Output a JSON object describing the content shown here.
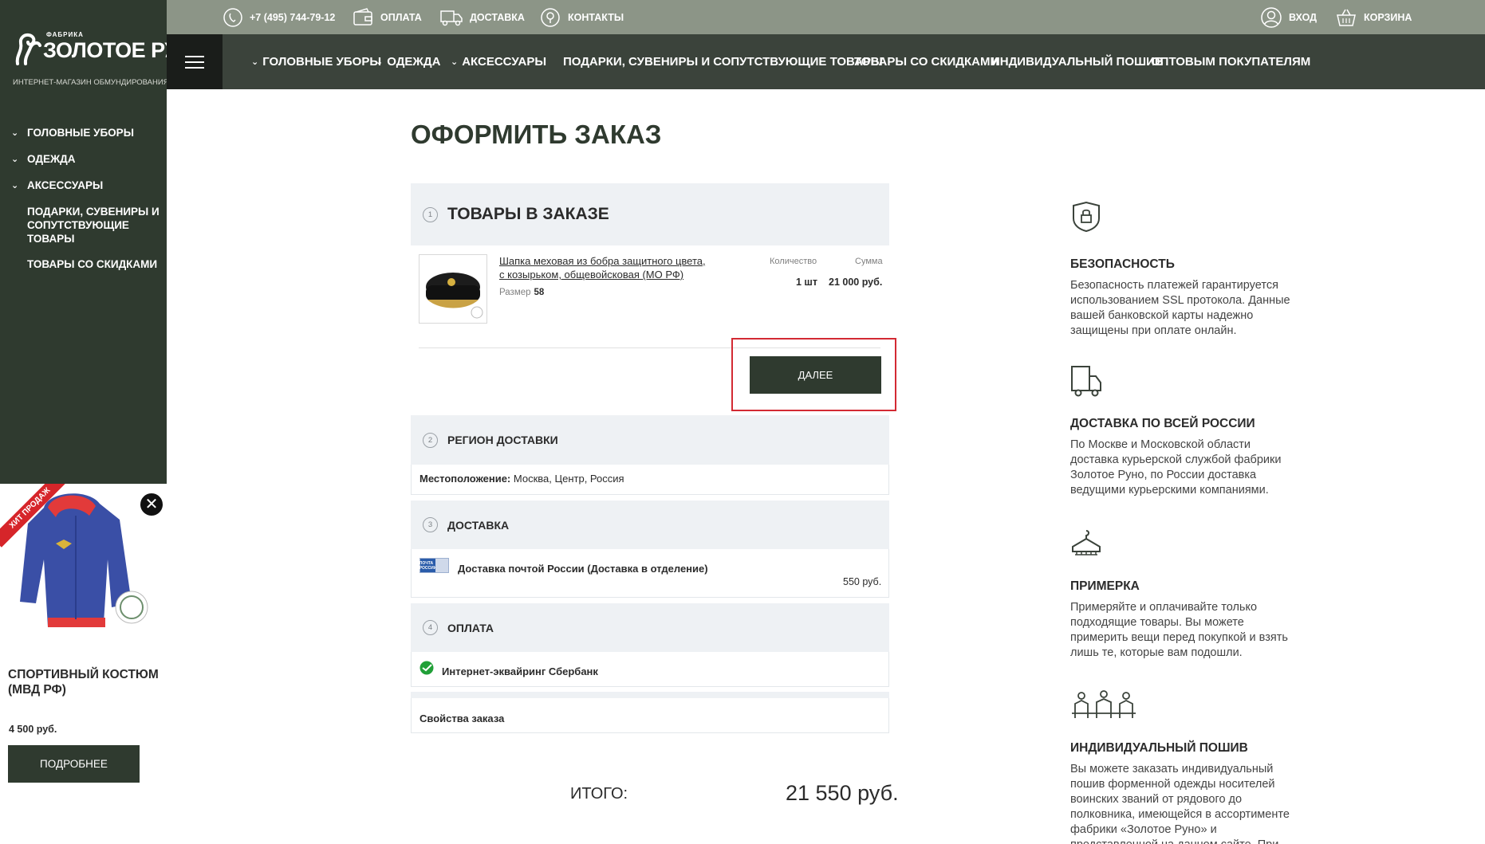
{
  "brand": {
    "small": "ФАБРИКА",
    "name": "ЗОЛОТОЕ РУНО",
    "tagline": "ИНТЕРНЕТ-МАГАЗИН ОБМУНДИРОВАНИЯ"
  },
  "topbar": {
    "phone": "+7 (495) 744-79-12",
    "payment": "ОПЛАТА",
    "delivery": "ДОСТАВКА",
    "contacts": "КОНТАКТЫ",
    "login": "ВХОД",
    "cart": "КОРЗИНА"
  },
  "main_nav": {
    "items": [
      {
        "label": "ГОЛОВНЫЕ УБОРЫ"
      },
      {
        "label": "ОДЕЖДА"
      },
      {
        "label": "АКСЕССУАРЫ"
      },
      {
        "label": "ПОДАРКИ, СУВЕНИРЫ И СОПУТСТВУЮЩИЕ ТОВАРЫ"
      },
      {
        "label": "ТОВАРЫ СО СКИДКАМИ"
      },
      {
        "label": "ИНДИВИДУАЛЬНЫЙ ПОШИВ"
      },
      {
        "label": "ОПТОВЫМ ПОКУПАТЕЛЯМ"
      }
    ]
  },
  "sidebar": {
    "items": [
      {
        "label": "ГОЛОВНЫЕ УБОРЫ"
      },
      {
        "label": "ОДЕЖДА"
      },
      {
        "label": "АКСЕССУАРЫ"
      },
      {
        "label": "ПОДАРКИ, СУВЕНИРЫ И СОПУТСТВУЮЩИЕ ТОВАРЫ"
      },
      {
        "label": "ТОВАРЫ СО СКИДКАМИ"
      }
    ]
  },
  "promo": {
    "ribbon": "ХИТ ПРОДАЖ",
    "title": "СПОРТИВНЫЙ КОСТЮМ (МВД РФ)",
    "price": "4 500 руб.",
    "button": "ПОДРОБНЕЕ"
  },
  "order": {
    "title": "ОФОРМИТЬ ЗАКАЗ",
    "section1": {
      "num": "1",
      "title": "ТОВАРЫ В ЗАКАЗЕ"
    },
    "product": {
      "name": "Шапка меховая из бобра защитного цвета, с козырьком, общевойсковая (МО РФ)",
      "size_label": "Размер",
      "size_value": "58",
      "qty_label": "Количество",
      "sum_label": "Сумма",
      "qty": "1 шт",
      "sum": "21 000 руб."
    },
    "next_button": "ДАЛЕЕ",
    "section2": {
      "num": "2",
      "title": "РЕГИОН ДОСТАВКИ",
      "location_label": "Местоположение:",
      "location_value": "Москва, Центр, Россия"
    },
    "section3": {
      "num": "3",
      "title": "ДОСТАВКА",
      "method": "Доставка почтой России (Доставка в отделение)",
      "price": "550 руб.",
      "logo_text": "ПОЧТА РОССИИ"
    },
    "section4": {
      "num": "4",
      "title": "ОПЛАТА",
      "method": "Интернет-эквайринг Сбербанк"
    },
    "properties": "Свойства заказа",
    "total_label": "ИТОГО:",
    "total_value": "21 550 руб."
  },
  "features": [
    {
      "icon": "shield-lock-icon",
      "title": "БЕЗОПАСНОСТЬ",
      "text": "Безопасность платежей гарантируется использованием SSL протокола. Данные вашей банковской карты надежно защищены при оплате онлайн."
    },
    {
      "icon": "truck-icon",
      "title": "ДОСТАВКА ПО ВСЕЙ РОССИИ",
      "text": "По Москве и Московской области доставка курьерской службой фабрики Золотое Руно, по России доставка ведущими курьерскими компаниями."
    },
    {
      "icon": "hanger-icon",
      "title": "ПРИМЕРКА",
      "text": "Примеряйте и оплачивайте только подходящие товары. Вы можете примерить вещи перед покупкой и взять лишь те, которые вам подошли."
    },
    {
      "icon": "tailoring-icon",
      "title": "ИНДИВИДУАЛЬНЫЙ ПОШИВ",
      "text": "Вы можете заказать индивидуальный пошив форменной одежды носителей воинских званий от рядового до полковника, имеющейся в ассортименте фабрики «Золотое Руно» и представленной на данном сайте. При оформлении заказа"
    }
  ],
  "colors": {
    "sidebar": "#2f3a2f",
    "topbar": "#8c9587",
    "mainnav": "#3b433b",
    "accent_red": "#d32a33",
    "block_bg": "#eef1f4"
  }
}
